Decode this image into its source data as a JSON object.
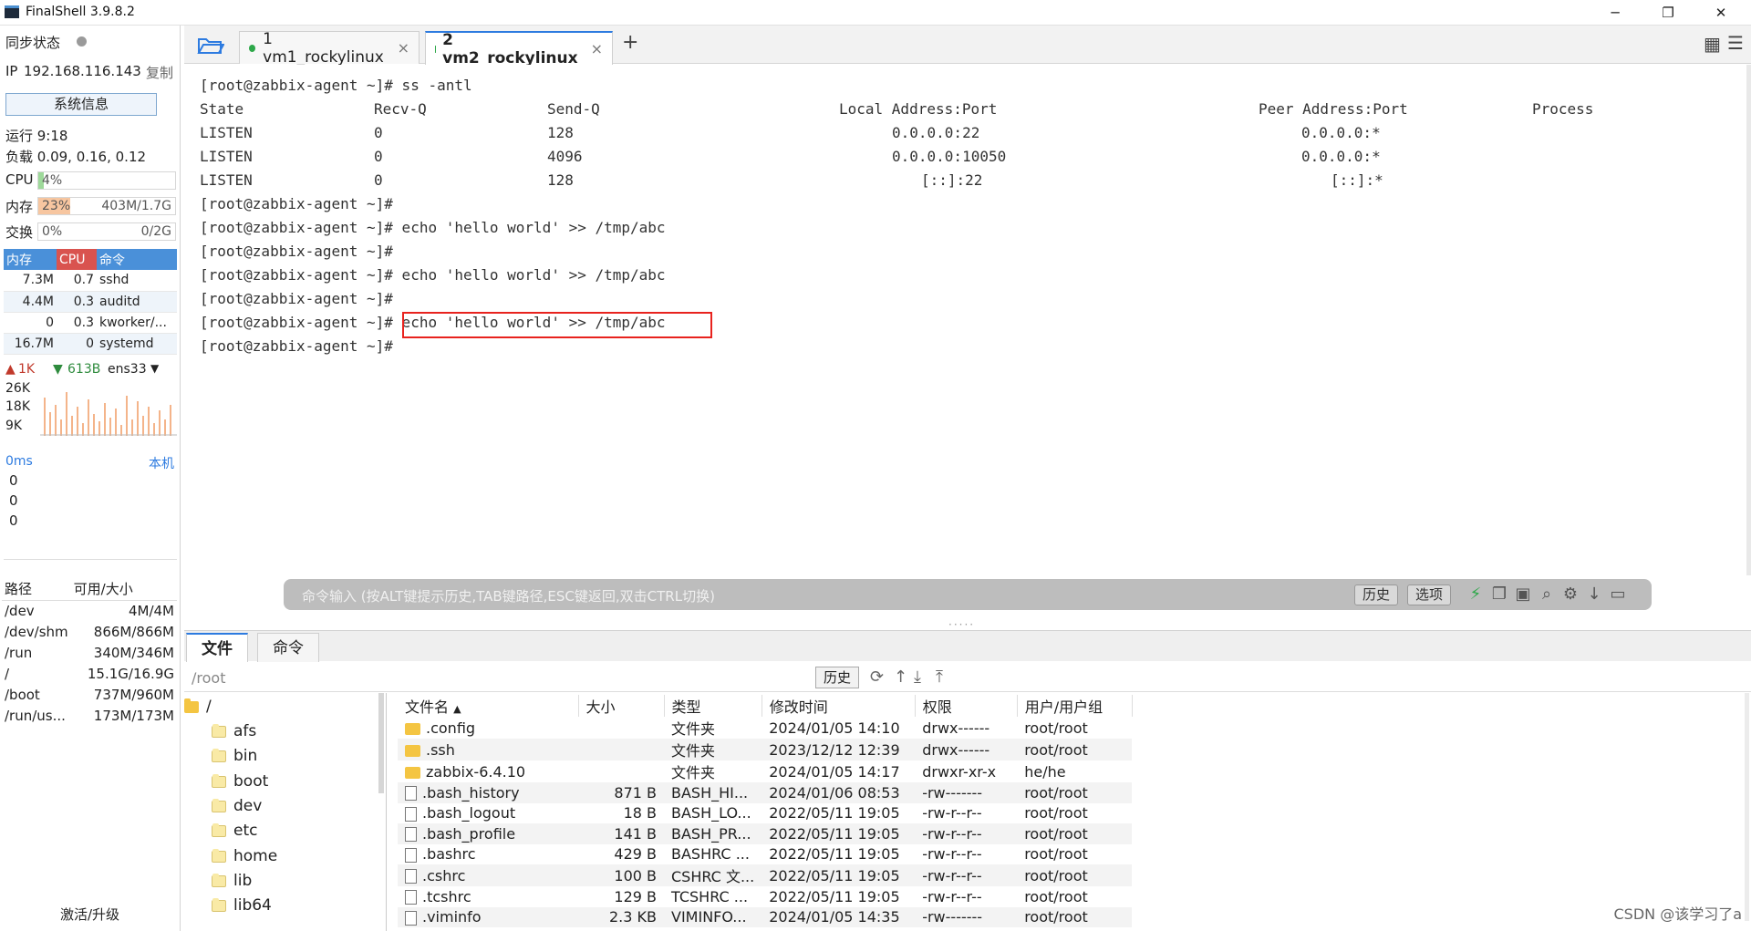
{
  "window": {
    "title": "FinalShell 3.9.8.2",
    "min": "─",
    "max": "❐",
    "close": "✕"
  },
  "sidebar": {
    "sync_label": "同步状态",
    "ip_label": "IP",
    "ip": "192.168.116.143",
    "copy": "复制",
    "sysinfo_button": "系统信息",
    "uptime": "运行 9:18",
    "load": "负载 0.09, 0.16, 0.12",
    "cpu_label": "CPU",
    "cpu_value": "4%",
    "cpu_fraction": 0.04,
    "mem_label": "内存",
    "mem_value": "23%",
    "mem_detail": "403M/1.7G",
    "mem_fraction": 0.23,
    "swap_label": "交换",
    "swap_value": "0%",
    "swap_detail": "0/2G",
    "proc_headers": {
      "mem": "内存",
      "cpu": "CPU",
      "cmd": "命令"
    },
    "processes": [
      {
        "mem": "7.3M",
        "cpu": "0.7",
        "cmd": "sshd"
      },
      {
        "mem": "4.4M",
        "cpu": "0.3",
        "cmd": "auditd"
      },
      {
        "mem": "0",
        "cpu": "0.3",
        "cmd": "kworker/..."
      },
      {
        "mem": "16.7M",
        "cpu": "0",
        "cmd": "systemd"
      }
    ],
    "net_up": "1K",
    "net_down": "613B",
    "net_iface": "ens33",
    "net_ticks": [
      "26K",
      "18K",
      "9K"
    ],
    "ping_ms": "0ms",
    "ping_host": "本机",
    "ping_values": [
      "0",
      "0",
      "0"
    ],
    "disk_headers": {
      "path": "路径",
      "avail": "可用/大小"
    },
    "disks": [
      {
        "path": "/dev",
        "avail": "4M/4M"
      },
      {
        "path": "/dev/shm",
        "avail": "866M/866M"
      },
      {
        "path": "/run",
        "avail": "340M/346M"
      },
      {
        "path": "/",
        "avail": "15.1G/16.9G"
      },
      {
        "path": "/boot",
        "avail": "737M/960M"
      },
      {
        "path": "/run/us...",
        "avail": "173M/173M"
      }
    ],
    "activate": "激活/升级"
  },
  "tabs": [
    {
      "label": "1 vm1_rockylinux",
      "close": "×"
    },
    {
      "label": "2 vm2_rockylinux",
      "close": "×"
    }
  ],
  "terminal": {
    "prompt_cmd": "[root@zabbix-agent ~]# ss -antl",
    "headers": [
      "State",
      "Recv-Q",
      "Send-Q",
      "Local Address:Port",
      "Peer Address:Port",
      "Process"
    ],
    "rows": [
      [
        "LISTEN",
        "0",
        "128",
        "0.0.0.0:22",
        "0.0.0.0:*"
      ],
      [
        "LISTEN",
        "0",
        "4096",
        "0.0.0.0:10050",
        "0.0.0.0:*"
      ],
      [
        "LISTEN",
        "0",
        "128",
        "[::]:22",
        "[::]:*"
      ]
    ],
    "lines_after": [
      "[root@zabbix-agent ~]#",
      "[root@zabbix-agent ~]# echo 'hello world' >> /tmp/abc",
      "[root@zabbix-agent ~]#",
      "[root@zabbix-agent ~]# echo 'hello world' >> /tmp/abc",
      "[root@zabbix-agent ~]#",
      "[root@zabbix-agent ~]# echo 'hello world' >> /tmp/abc",
      "[root@zabbix-agent ~]#"
    ]
  },
  "cmdbar": {
    "placeholder": "命令输入 (按ALT键提示历史,TAB键路径,ESC键返回,双击CTRL切换)",
    "history": "历史",
    "options": "选项"
  },
  "bottom": {
    "tab_files": "文件",
    "tab_commands": "命令",
    "path": "/root",
    "history_btn": "历史",
    "tree": [
      "/",
      "afs",
      "bin",
      "boot",
      "dev",
      "etc",
      "home",
      "lib",
      "lib64"
    ],
    "columns": [
      "文件名",
      "大小",
      "类型",
      "修改时间",
      "权限",
      "用户/用户组"
    ],
    "files": [
      {
        "name": ".config",
        "size": "",
        "type": "文件夹",
        "mtime": "2024/01/05 14:10",
        "perm": "drwx------",
        "owner": "root/root",
        "dir": true
      },
      {
        "name": ".ssh",
        "size": "",
        "type": "文件夹",
        "mtime": "2023/12/12 12:39",
        "perm": "drwx------",
        "owner": "root/root",
        "dir": true
      },
      {
        "name": "zabbix-6.4.10",
        "size": "",
        "type": "文件夹",
        "mtime": "2024/01/05 14:17",
        "perm": "drwxr-xr-x",
        "owner": "he/he",
        "dir": true
      },
      {
        "name": ".bash_history",
        "size": "871 B",
        "type": "BASH_HI...",
        "mtime": "2024/01/06 08:53",
        "perm": "-rw-------",
        "owner": "root/root",
        "dir": false
      },
      {
        "name": ".bash_logout",
        "size": "18 B",
        "type": "BASH_LO...",
        "mtime": "2022/05/11 19:05",
        "perm": "-rw-r--r--",
        "owner": "root/root",
        "dir": false
      },
      {
        "name": ".bash_profile",
        "size": "141 B",
        "type": "BASH_PR...",
        "mtime": "2022/05/11 19:05",
        "perm": "-rw-r--r--",
        "owner": "root/root",
        "dir": false
      },
      {
        "name": ".bashrc",
        "size": "429 B",
        "type": "BASHRC ...",
        "mtime": "2022/05/11 19:05",
        "perm": "-rw-r--r--",
        "owner": "root/root",
        "dir": false
      },
      {
        "name": ".cshrc",
        "size": "100 B",
        "type": "CSHRC 文...",
        "mtime": "2022/05/11 19:05",
        "perm": "-rw-r--r--",
        "owner": "root/root",
        "dir": false
      },
      {
        "name": ".tcshrc",
        "size": "129 B",
        "type": "TCSHRC ...",
        "mtime": "2022/05/11 19:05",
        "perm": "-rw-r--r--",
        "owner": "root/root",
        "dir": false
      },
      {
        "name": ".viminfo",
        "size": "2.3 KB",
        "type": "VIMINFO...",
        "mtime": "2024/01/05 14:35",
        "perm": "-rw-------",
        "owner": "root/root",
        "dir": false
      }
    ]
  },
  "watermark": "CSDN @该学习了a",
  "colors": {
    "accent": "#2d7be0",
    "highlight": "#e8231e",
    "cpu_bar": "#9ed99a",
    "mem_bar": "#f7c6a0",
    "proc_header": "#4a90d9",
    "cpu_header": "#d9534f"
  }
}
